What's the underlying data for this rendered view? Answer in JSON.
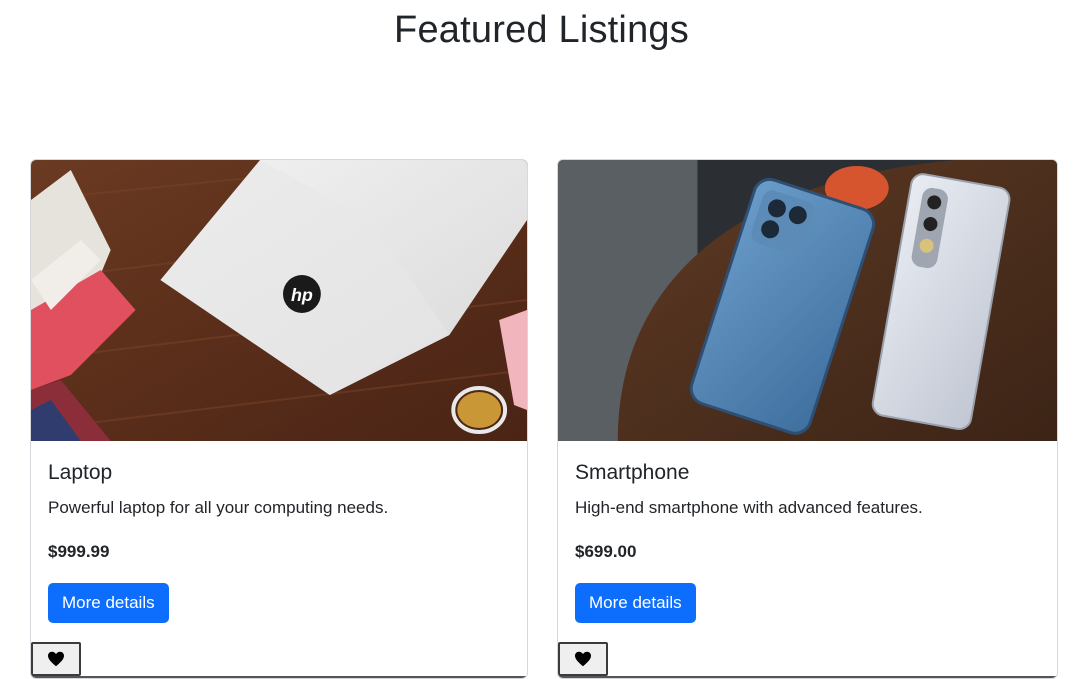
{
  "page": {
    "title": "Featured Listings"
  },
  "listings": [
    {
      "title": "Laptop",
      "description": "Powerful laptop for all your computing needs.",
      "price": "$999.99",
      "button_label": "More details",
      "image": "laptop-photo",
      "favorite_icon": "heart-icon"
    },
    {
      "title": "Smartphone",
      "description": "High-end smartphone with advanced features.",
      "price": "$699.00",
      "button_label": "More details",
      "image": "smartphones-photo",
      "favorite_icon": "heart-icon"
    }
  ],
  "colors": {
    "primary": "#0d6efd",
    "text": "#212529",
    "border": "#d5d8dc"
  }
}
